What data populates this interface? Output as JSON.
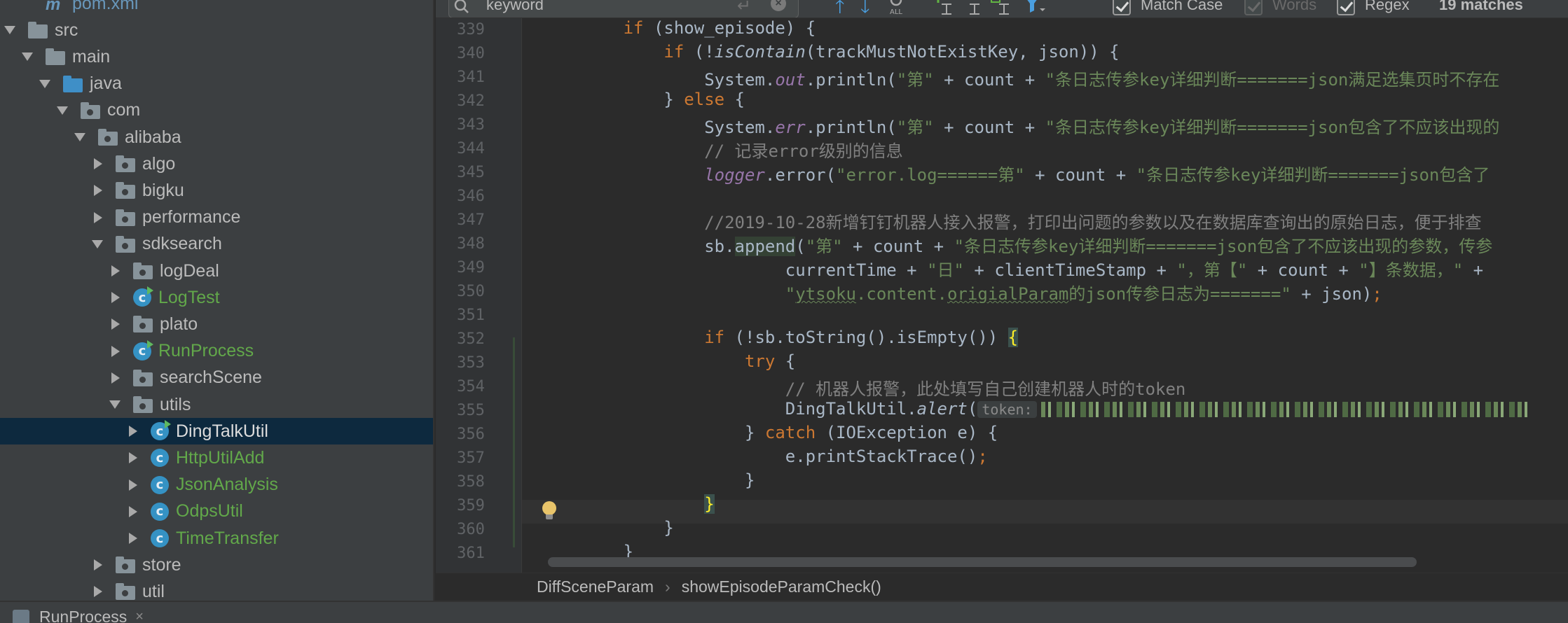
{
  "project_tree": {
    "items": [
      {
        "label": "pom.xml",
        "depth": 1,
        "arrow": "none",
        "icon": "maven-file-icon",
        "color": "pom"
      },
      {
        "label": "src",
        "depth": 0,
        "arrow": "down",
        "icon": "folder-icon",
        "color": "normal"
      },
      {
        "label": "main",
        "depth": 1,
        "arrow": "down",
        "icon": "folder-icon",
        "color": "normal"
      },
      {
        "label": "java",
        "depth": 2,
        "arrow": "down",
        "icon": "source-folder-icon",
        "color": "normal"
      },
      {
        "label": "com",
        "depth": 3,
        "arrow": "down",
        "icon": "package-icon",
        "color": "normal"
      },
      {
        "label": "alibaba",
        "depth": 4,
        "arrow": "down",
        "icon": "package-icon",
        "color": "normal"
      },
      {
        "label": "algo",
        "depth": 5,
        "arrow": "right",
        "icon": "package-icon",
        "color": "normal"
      },
      {
        "label": "bigku",
        "depth": 5,
        "arrow": "right",
        "icon": "package-icon",
        "color": "normal"
      },
      {
        "label": "performance",
        "depth": 5,
        "arrow": "right",
        "icon": "package-icon",
        "color": "normal"
      },
      {
        "label": "sdksearch",
        "depth": 5,
        "arrow": "down",
        "icon": "package-icon",
        "color": "normal"
      },
      {
        "label": "logDeal",
        "depth": 6,
        "arrow": "right",
        "icon": "package-icon",
        "color": "normal"
      },
      {
        "label": "LogTest",
        "depth": 6,
        "arrow": "right",
        "icon": "runnable-class-icon",
        "color": "green"
      },
      {
        "label": "plato",
        "depth": 6,
        "arrow": "right",
        "icon": "package-icon",
        "color": "normal"
      },
      {
        "label": "RunProcess",
        "depth": 6,
        "arrow": "right",
        "icon": "runnable-class-icon",
        "color": "green"
      },
      {
        "label": "searchScene",
        "depth": 6,
        "arrow": "right",
        "icon": "package-icon",
        "color": "normal"
      },
      {
        "label": "utils",
        "depth": 6,
        "arrow": "down",
        "icon": "package-icon",
        "color": "normal"
      },
      {
        "label": "DingTalkUtil",
        "depth": 7,
        "arrow": "right",
        "icon": "runnable-class-icon",
        "color": "normal",
        "selected": true
      },
      {
        "label": "HttpUtilAdd",
        "depth": 7,
        "arrow": "right",
        "icon": "class-icon",
        "color": "green"
      },
      {
        "label": "JsonAnalysis",
        "depth": 7,
        "arrow": "right",
        "icon": "class-icon",
        "color": "green"
      },
      {
        "label": "OdpsUtil",
        "depth": 7,
        "arrow": "right",
        "icon": "class-icon",
        "color": "green"
      },
      {
        "label": "TimeTransfer",
        "depth": 7,
        "arrow": "right",
        "icon": "class-icon",
        "color": "green"
      },
      {
        "label": "store",
        "depth": 5,
        "arrow": "right",
        "icon": "package-icon",
        "color": "normal"
      },
      {
        "label": "util",
        "depth": 5,
        "arrow": "right",
        "icon": "package-icon",
        "color": "normal"
      }
    ]
  },
  "search": {
    "value": "keyword",
    "match_case_label": "Match Case",
    "match_case_checked": true,
    "words_label": "Words",
    "words_checked": true,
    "words_disabled": true,
    "regex_label": "Regex",
    "regex_checked": true,
    "matches": "19 matches"
  },
  "editor": {
    "line_numbers": [
      "339",
      "340",
      "341",
      "342",
      "343",
      "344",
      "345",
      "346",
      "347",
      "348",
      "349",
      "350",
      "351",
      "352",
      "353",
      "354",
      "355",
      "356",
      "357",
      "358",
      "359",
      "360",
      "361"
    ],
    "hint_label": "token:",
    "brace": "{",
    "brace_close": "}"
  },
  "breadcrumb": {
    "class_name": "DiffSceneParam",
    "method_name": "showEpisodeParamCheck()"
  },
  "bottom_bar": {
    "run_tab": "RunProcess"
  },
  "colors": {
    "keyword": "#cc7832",
    "string": "#6a8759",
    "comment": "#808080",
    "field": "#9876aa",
    "text": "#a9b7c6",
    "green_file": "#62a84a",
    "selection": "#0d293e"
  }
}
